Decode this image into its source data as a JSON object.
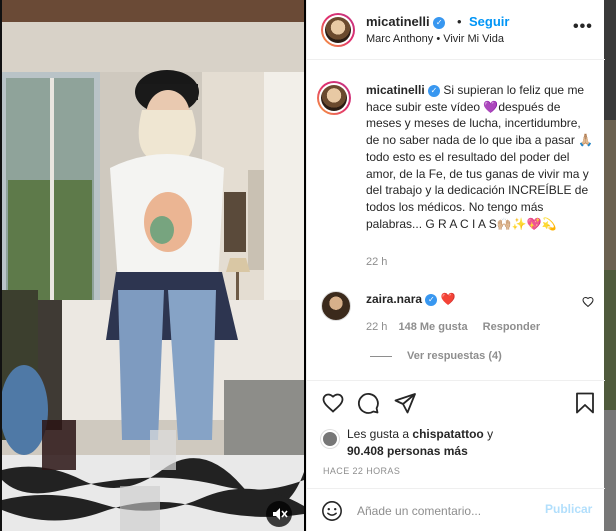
{
  "post": {
    "username": "micatinelli",
    "follow_label": "Seguir",
    "separator": "•",
    "audio": "Marc Anthony • Vivir Mi Vida",
    "more_label": "•••"
  },
  "caption": {
    "username": "micatinelli",
    "text": " Si supieran lo feliz que me hace subir este vídeo 💜después de meses y meses de lucha, incertidumbre, de no saber nada de lo que iba a pasar 🙏🏼todo esto es el resultado del poder del amor, de la Fe, de tus ganas de vivir ma y del trabajo y la dedicación INCREÍBLE de todos los médicos. No tengo más palabras... G R A C I A S🙌🏼✨💖💫",
    "time": "22 h"
  },
  "comment": {
    "username": "zaira.nara",
    "heart": "❤️",
    "time": "22 h",
    "likes": "148 Me gusta",
    "reply_label": "Responder",
    "view_replies": "Ver respuestas (4)"
  },
  "likes": {
    "prefix": "Les gusta a ",
    "user": "chispatattoo",
    "connector": " y",
    "count": "90.408 personas más"
  },
  "timeago": "HACE 22 HORAS",
  "add_comment": {
    "placeholder": "Añade un comentario...",
    "publish_label": "Publicar"
  },
  "icons": {
    "verified": "verified-badge-icon",
    "like": "heart-icon",
    "comment": "comment-bubble-icon",
    "share": "paper-plane-icon",
    "save": "bookmark-icon",
    "emoji": "smiley-icon",
    "mute": "speaker-muted-icon"
  },
  "colors": {
    "accent": "#0095f6",
    "verified": "#3897f0",
    "muted_text": "#8e8e8e",
    "heart_red": "#ed4956",
    "publish_disabled": "#b2dffc"
  }
}
